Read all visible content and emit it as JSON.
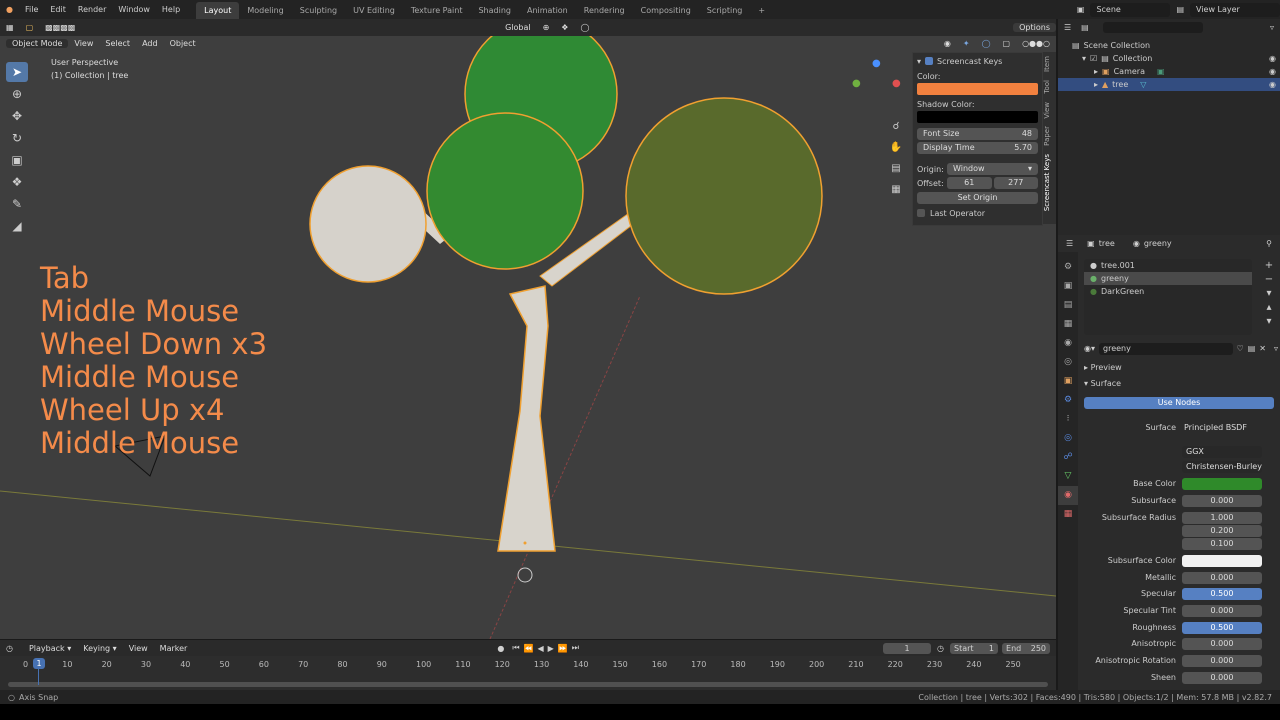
{
  "menu": {
    "items": [
      "File",
      "Edit",
      "Render",
      "Window",
      "Help"
    ]
  },
  "workspaces": [
    "Layout",
    "Modeling",
    "Sculpting",
    "UV Editing",
    "Texture Paint",
    "Shading",
    "Animation",
    "Rendering",
    "Compositing",
    "Scripting"
  ],
  "active_workspace": "Layout",
  "scene": {
    "name": "Scene",
    "view_layer": "View Layer"
  },
  "viewport": {
    "mode": "Object Mode",
    "menus": [
      "View",
      "Select",
      "Add",
      "Object"
    ],
    "transform": "Global",
    "options": "Options",
    "info_line1": "User Perspective",
    "info_line2": "(1) Collection | tree"
  },
  "screencast_keys": [
    "Tab",
    "Middle Mouse",
    "Wheel Down x3",
    "Middle Mouse",
    "Wheel Up x4",
    "Middle Mouse"
  ],
  "npanel": {
    "title": "Screencast Keys",
    "color_label": "Color:",
    "color": "#f2813f",
    "shadow_label": "Shadow Color:",
    "shadow": "#000000",
    "font_size_label": "Font Size",
    "font_size": "48",
    "display_time_label": "Display Time",
    "display_time": "5.70",
    "origin_label": "Origin:",
    "origin": "Window",
    "offset_label": "Offset:",
    "offset_x": "61",
    "offset_y": "277",
    "set_origin": "Set Origin",
    "last_operator": "Last Operator",
    "tabs": [
      "Item",
      "Tool",
      "View",
      "Paper",
      "Screencast Keys"
    ]
  },
  "outliner": {
    "root": "Scene Collection",
    "collection": "Collection",
    "camera": "Camera",
    "tree": "tree"
  },
  "properties": {
    "object": "tree",
    "material": "greeny",
    "slots": [
      "tree.001",
      "greeny",
      "DarkGreen"
    ],
    "material_field": "greeny",
    "preview": "Preview",
    "surface_panel": "Surface",
    "use_nodes": "Use Nodes",
    "surface_label": "Surface",
    "surface_value": "Principled BSDF",
    "distribution": "GGX",
    "subsurface_method": "Christensen-Burley",
    "base_color_label": "Base Color",
    "base_color": "#2f8a2a",
    "rows": [
      {
        "label": "Subsurface",
        "value": "0.000"
      },
      {
        "label": "Subsurface Radius",
        "value": "1.000"
      },
      {
        "label": "",
        "value": "0.200"
      },
      {
        "label": "",
        "value": "0.100"
      },
      {
        "label": "Subsurface Color",
        "value": ""
      },
      {
        "label": "Metallic",
        "value": "0.000"
      },
      {
        "label": "Specular",
        "value": "0.500"
      },
      {
        "label": "Specular Tint",
        "value": "0.000"
      },
      {
        "label": "Roughness",
        "value": "0.500"
      },
      {
        "label": "Anisotropic",
        "value": "0.000"
      },
      {
        "label": "Anisotropic Rotation",
        "value": "0.000"
      },
      {
        "label": "Sheen",
        "value": "0.000"
      }
    ]
  },
  "timeline": {
    "menus": [
      "Playback",
      "Keying",
      "View",
      "Marker"
    ],
    "current_frame": "1",
    "start_label": "Start",
    "start": "1",
    "end_label": "End",
    "end": "250",
    "ticks": [
      "0",
      "10",
      "20",
      "30",
      "40",
      "50",
      "60",
      "70",
      "80",
      "90",
      "100",
      "110",
      "120",
      "130",
      "140",
      "150",
      "160",
      "170",
      "180",
      "190",
      "200",
      "210",
      "220",
      "230",
      "240",
      "250"
    ],
    "playhead": "1"
  },
  "status": {
    "left": "Axis Snap",
    "right": "Collection | tree | Verts:302 | Faces:490 | Tris:580 | Objects:1/2 | Mem: 57.8 MB | v2.82.7"
  }
}
